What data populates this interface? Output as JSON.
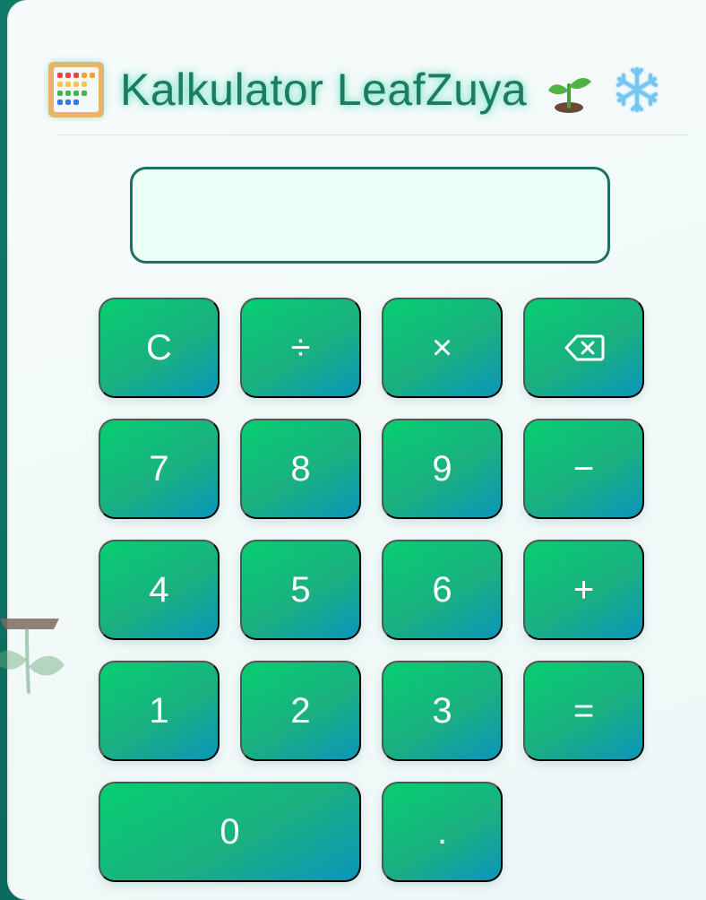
{
  "app": {
    "title": "Kalkulator LeafZuya"
  },
  "display": {
    "value": ""
  },
  "keys": [
    {
      "label": "C",
      "name": "clear-button"
    },
    {
      "label": "÷",
      "name": "divide-button"
    },
    {
      "label": "×",
      "name": "multiply-button"
    },
    {
      "label": "⌫",
      "name": "backspace-button"
    },
    {
      "label": "7",
      "name": "digit-7-button"
    },
    {
      "label": "8",
      "name": "digit-8-button"
    },
    {
      "label": "9",
      "name": "digit-9-button"
    },
    {
      "label": "−",
      "name": "subtract-button"
    },
    {
      "label": "4",
      "name": "digit-4-button"
    },
    {
      "label": "5",
      "name": "digit-5-button"
    },
    {
      "label": "6",
      "name": "digit-6-button"
    },
    {
      "label": "+",
      "name": "add-button"
    },
    {
      "label": "1",
      "name": "digit-1-button"
    },
    {
      "label": "2",
      "name": "digit-2-button"
    },
    {
      "label": "3",
      "name": "digit-3-button"
    },
    {
      "label": "=",
      "name": "equals-button"
    },
    {
      "label": "0",
      "name": "digit-0-button"
    },
    {
      "label": ".",
      "name": "decimal-point-button"
    }
  ],
  "colors": {
    "accent": "#1c7b61",
    "button_start": "#06cf71",
    "button_end": "#0a96bb",
    "display_border": "#1f6f63",
    "display_bg": "#ebfff6"
  },
  "icons": {
    "left": "abacus-icon",
    "right_1": "seedling-icon",
    "right_2": "snowflake-icon",
    "decor": "sprout-decor-icon"
  }
}
